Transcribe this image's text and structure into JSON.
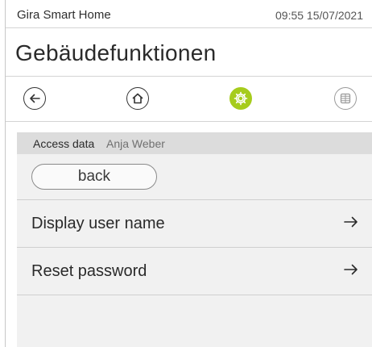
{
  "status_bar": {
    "app_name": "Gira Smart Home",
    "datetime": "09:55 15/07/2021"
  },
  "page": {
    "title": "Gebäudefunktionen"
  },
  "nav": {
    "icons": [
      "back-arrow-icon",
      "home-icon",
      "settings-gear-icon",
      "grid-icon"
    ],
    "active_color": "#a6cc1c"
  },
  "section": {
    "label": "Access data",
    "value": "Anja Weber"
  },
  "actions": {
    "back_label": "back"
  },
  "menu": {
    "items": [
      {
        "label": "Display user name",
        "icon": "arrow-right-icon"
      },
      {
        "label": "Reset password",
        "icon": "arrow-right-icon"
      }
    ]
  }
}
